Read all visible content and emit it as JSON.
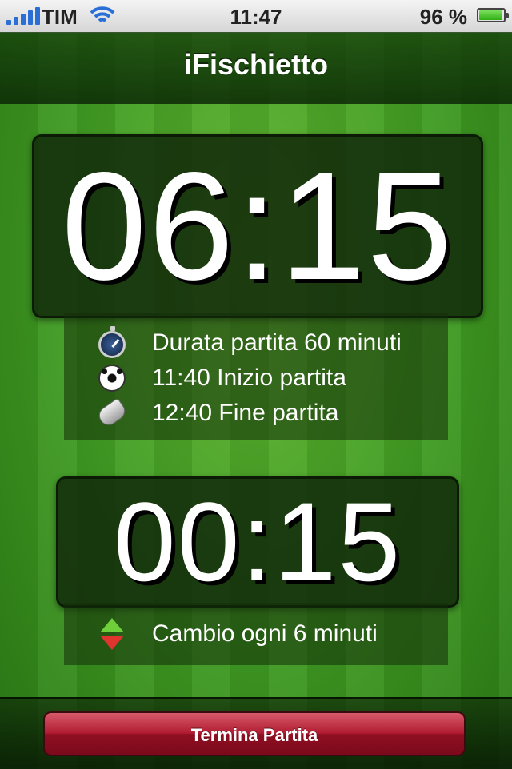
{
  "status_bar": {
    "carrier": "TIM",
    "time": "11:47",
    "battery_percent": "96 %",
    "battery_level": 0.96
  },
  "nav": {
    "title": "iFischietto"
  },
  "match_timer": {
    "value": "06:15",
    "info": [
      {
        "icon": "stopwatch-icon",
        "text": "Durata partita 60 minuti"
      },
      {
        "icon": "soccer-ball-icon",
        "text": "11:40 Inizio partita"
      },
      {
        "icon": "whistle-icon",
        "text": "12:40 Fine partita"
      }
    ]
  },
  "substitution_timer": {
    "value": "00:15",
    "info": [
      {
        "icon": "swap-arrows-icon",
        "text": "Cambio ogni 6 minuti"
      }
    ]
  },
  "toolbar": {
    "end_button_label": "Termina Partita"
  },
  "colors": {
    "pitch": "#3f9a22",
    "button": "#b21c32",
    "signal": "#2a6fd6"
  }
}
